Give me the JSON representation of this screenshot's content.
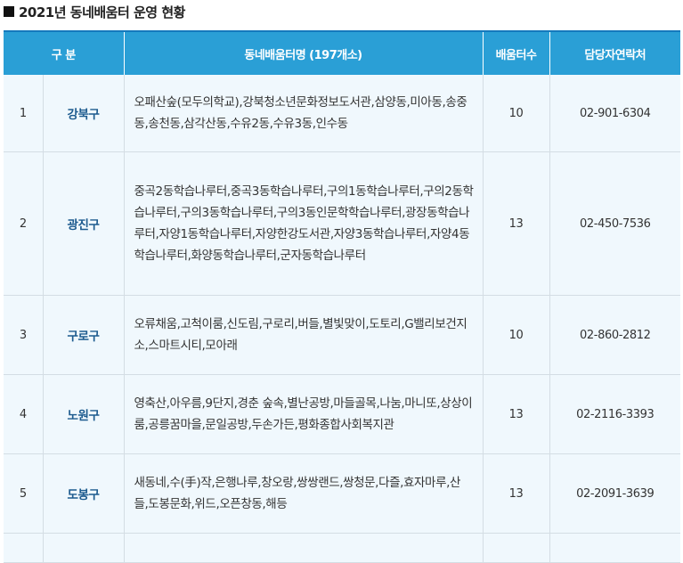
{
  "title": "2021년 동네배움터 운영 현황",
  "headers": {
    "category": "구 분",
    "names": "동네배움터명 (197개소)",
    "count": "배움터수",
    "contact": "담당자연락처"
  },
  "rows": [
    {
      "no": "1",
      "gu": "강북구",
      "names": "오패산숲(모두의학교),강북청소년문화정보도서관,삼양동,미아동,송중동,송천동,삼각산동,수유2동,수유3동,인수동",
      "count": "10",
      "contact": "02-901-6304"
    },
    {
      "no": "2",
      "gu": "광진구",
      "names": "중곡2동학습나루터,중곡3동학습나루터,구의1동학습나루터,구의2동학습나루터,구의3동학습나루터,구의3동인문학학습나루터,광장동학습나루터,자양1동학습나루터,자양한강도서관,자양3동학습나루터,자양4동학습나루터,화양동학습나루터,군자동학습나루터",
      "count": "13",
      "contact": "02-450-7536"
    },
    {
      "no": "3",
      "gu": "구로구",
      "names": "오류채움,고척이룸,신도림,구로리,버들,별빛맞이,도토리,G밸리보건지소,스마트시티,모아래",
      "count": "10",
      "contact": "02-860-2812"
    },
    {
      "no": "4",
      "gu": "노원구",
      "names": "영축산,아우름,9단지,경춘 숲속,별난공방,마들골목,나눔,마니또,상상이룸,공릉꿈마을,문일공방,두손가든,평화종합사회복지관",
      "count": "13",
      "contact": "02-2116-3393"
    },
    {
      "no": "5",
      "gu": "도봉구",
      "names": "새동네,수(手)작,은행나루,창오랑,쌍쌍랜드,쌍청문,다즐,효자마루,산들,도봉문화,위드,오픈창동,해등",
      "count": "13",
      "contact": "02-2091-3639"
    }
  ]
}
